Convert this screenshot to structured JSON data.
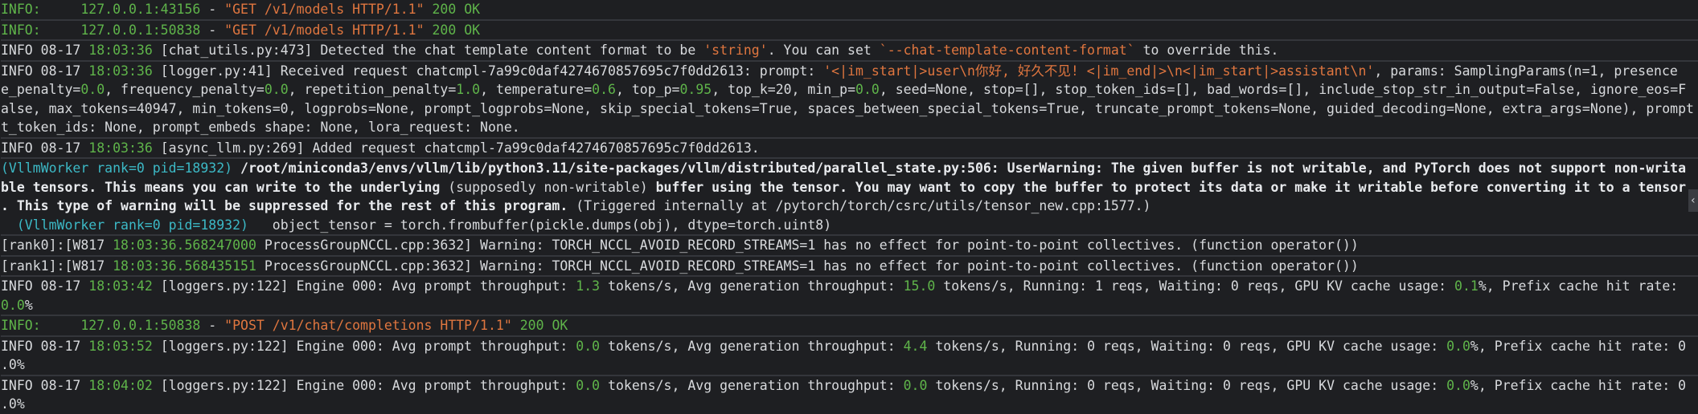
{
  "colors": {
    "background": "#1e1f22",
    "green": "#5fb44a",
    "orange": "#e0763f",
    "cyan": "#3cb9c6",
    "text": "#d8dadd"
  },
  "lines": [
    {
      "segments": [
        {
          "t": "INFO:     ",
          "cls": "g"
        },
        {
          "t": "127.0.0.1:43156",
          "cls": "g"
        },
        {
          "t": " - ",
          "cls": "w"
        },
        {
          "t": "\"GET /v1/models HTTP/1.1\"",
          "cls": "o"
        },
        {
          "t": " 200 OK",
          "cls": "g"
        }
      ],
      "sep": true
    },
    {
      "segments": [
        {
          "t": "INFO:     ",
          "cls": "g"
        },
        {
          "t": "127.0.0.1:50838",
          "cls": "g"
        },
        {
          "t": " - ",
          "cls": "w"
        },
        {
          "t": "\"GET /v1/models HTTP/1.1\"",
          "cls": "o"
        },
        {
          "t": " 200 OK",
          "cls": "g"
        }
      ],
      "sep": true
    },
    {
      "segments": [
        {
          "t": "INFO 08-17 ",
          "cls": "w"
        },
        {
          "t": "18:03:36",
          "cls": "g"
        },
        {
          "t": " [chat_utils.py:473] Detected the chat template content format to be ",
          "cls": "w"
        },
        {
          "t": "'string'",
          "cls": "o"
        },
        {
          "t": ". You can set ",
          "cls": "w"
        },
        {
          "t": "`--chat-template-content-format`",
          "cls": "o"
        },
        {
          "t": " to override this.",
          "cls": "w"
        }
      ],
      "sep": true
    },
    {
      "segments": [
        {
          "t": "INFO 08-17 ",
          "cls": "w"
        },
        {
          "t": "18:03:36",
          "cls": "g"
        },
        {
          "t": " [logger.py:41] Received request chatcmpl-7a99c0daf4274670857695c7f0dd2613: prompt: ",
          "cls": "w"
        },
        {
          "t": "'<|im_start|>user\\n你好, 好久不见! <|im_end|>\\n<|im_start|>assistant\\n'",
          "cls": "o"
        },
        {
          "t": ", params: SamplingParams(n=1, presence",
          "cls": "w"
        }
      ]
    },
    {
      "segments": [
        {
          "t": "e_penalty=",
          "cls": "w"
        },
        {
          "t": "0.0",
          "cls": "g"
        },
        {
          "t": ", frequency_penalty=",
          "cls": "w"
        },
        {
          "t": "0.0",
          "cls": "g"
        },
        {
          "t": ", repetition_penalty=",
          "cls": "w"
        },
        {
          "t": "1.0",
          "cls": "g"
        },
        {
          "t": ", temperature=",
          "cls": "w"
        },
        {
          "t": "0.6",
          "cls": "g"
        },
        {
          "t": ", top_p=",
          "cls": "w"
        },
        {
          "t": "0.95",
          "cls": "g"
        },
        {
          "t": ", top_k=20, min_p=",
          "cls": "w"
        },
        {
          "t": "0.0",
          "cls": "g"
        },
        {
          "t": ", seed=None, stop=[], stop_token_ids=[], bad_words=[], include_stop_str_in_output=False, ignore_eos=F",
          "cls": "w"
        }
      ]
    },
    {
      "segments": [
        {
          "t": "alse, max_tokens=40947, min_tokens=0, logprobs=None, prompt_logprobs=None, skip_special_tokens=True, spaces_between_special_tokens=True, truncate_prompt_tokens=None, guided_decoding=None, extra_args=None), prompt",
          "cls": "w"
        }
      ]
    },
    {
      "segments": [
        {
          "t": "t_token_ids: None, prompt_embeds shape: None, lora_request: None.",
          "cls": "w"
        }
      ],
      "sep": true
    },
    {
      "segments": [
        {
          "t": "INFO 08-17 ",
          "cls": "w"
        },
        {
          "t": "18:03:36",
          "cls": "g"
        },
        {
          "t": " [async_llm.py:269] Added request chatcmpl-7a99c0daf4274670857695c7f0dd2613.",
          "cls": "w"
        }
      ],
      "sep": true
    },
    {
      "segments": [
        {
          "t": "(VllmWorker rank=0 pid=18932)",
          "cls": "c"
        },
        {
          "t": " /root/miniconda3/envs/vllm/lib/python3.11/site-packages/vllm/distributed/parallel_state.py:506: UserWarning: The given buffer is not writable, and PyTorch does not support non-writa",
          "cls": "b"
        }
      ]
    },
    {
      "segments": [
        {
          "t": "ble tensors. This means you can write to the underlying ",
          "cls": "b"
        },
        {
          "t": "(supposedly non-writable)",
          "cls": "w"
        },
        {
          "t": " buffer using the tensor. You may want to copy the buffer to protect its data or make it writable before converting it to a tensor",
          "cls": "b"
        }
      ]
    },
    {
      "segments": [
        {
          "t": ". This type of warning will be suppressed for the rest of this program. ",
          "cls": "b"
        },
        {
          "t": "(Triggered internally at /pytorch/torch/csrc/utils/tensor_new.cpp:1577.)",
          "cls": "w"
        }
      ]
    },
    {
      "segments": [
        {
          "t": "  (VllmWorker rank=0 pid=18932)",
          "cls": "c"
        },
        {
          "t": "   object_tensor = torch.frombuffer(pickle.dumps(obj), dtype=torch.uint8)",
          "cls": "w"
        }
      ],
      "sep": true
    },
    {
      "segments": [
        {
          "t": "[rank0]:[W817 ",
          "cls": "w"
        },
        {
          "t": "18:03:36.568247000",
          "cls": "g"
        },
        {
          "t": " ProcessGroupNCCL.cpp:3632] Warning: TORCH_NCCL_AVOID_RECORD_STREAMS=1 has no effect for point-to-point collectives. (function operator())",
          "cls": "w"
        }
      ],
      "sep": true
    },
    {
      "segments": [
        {
          "t": "[rank1]:[W817 ",
          "cls": "w"
        },
        {
          "t": "18:03:36.568435151",
          "cls": "g"
        },
        {
          "t": " ProcessGroupNCCL.cpp:3632] Warning: TORCH_NCCL_AVOID_RECORD_STREAMS=1 has no effect for point-to-point collectives. (function operator())",
          "cls": "w"
        }
      ],
      "sep": true
    },
    {
      "segments": [
        {
          "t": "INFO 08-17 ",
          "cls": "w"
        },
        {
          "t": "18:03:42",
          "cls": "g"
        },
        {
          "t": " [loggers.py:122] Engine 000: Avg prompt throughput: ",
          "cls": "w"
        },
        {
          "t": "1.3",
          "cls": "g"
        },
        {
          "t": " tokens/s, Avg generation throughput: ",
          "cls": "w"
        },
        {
          "t": "15.0",
          "cls": "g"
        },
        {
          "t": " tokens/s, Running: 1 reqs, Waiting: 0 reqs, GPU KV cache usage: ",
          "cls": "w"
        },
        {
          "t": "0.1",
          "cls": "g"
        },
        {
          "t": "%, Prefix cache hit rate: ",
          "cls": "w"
        }
      ]
    },
    {
      "segments": [
        {
          "t": "0.0",
          "cls": "g"
        },
        {
          "t": "%",
          "cls": "w"
        }
      ],
      "sep": true
    },
    {
      "segments": [
        {
          "t": "INFO:     ",
          "cls": "g"
        },
        {
          "t": "127.0.0.1:50838",
          "cls": "g"
        },
        {
          "t": " - ",
          "cls": "w"
        },
        {
          "t": "\"POST /v1/chat/completions HTTP/1.1\"",
          "cls": "o"
        },
        {
          "t": " 200 OK",
          "cls": "g"
        }
      ],
      "sep": true
    },
    {
      "segments": [
        {
          "t": "INFO 08-17 ",
          "cls": "w"
        },
        {
          "t": "18:03:52",
          "cls": "g"
        },
        {
          "t": " [loggers.py:122] Engine 000: Avg prompt throughput: ",
          "cls": "w"
        },
        {
          "t": "0.0",
          "cls": "g"
        },
        {
          "t": " tokens/s, Avg generation throughput: ",
          "cls": "w"
        },
        {
          "t": "4.4",
          "cls": "g"
        },
        {
          "t": " tokens/s, Running: 0 reqs, Waiting: 0 reqs, GPU KV cache usage: ",
          "cls": "w"
        },
        {
          "t": "0.0",
          "cls": "g"
        },
        {
          "t": "%, Prefix cache hit rate: 0",
          "cls": "w"
        }
      ]
    },
    {
      "segments": [
        {
          "t": ".0%",
          "cls": "w"
        }
      ],
      "sep": true
    },
    {
      "segments": [
        {
          "t": "INFO 08-17 ",
          "cls": "w"
        },
        {
          "t": "18:04:02",
          "cls": "g"
        },
        {
          "t": " [loggers.py:122] Engine 000: Avg prompt throughput: ",
          "cls": "w"
        },
        {
          "t": "0.0",
          "cls": "g"
        },
        {
          "t": " tokens/s, Avg generation throughput: ",
          "cls": "w"
        },
        {
          "t": "0.0",
          "cls": "g"
        },
        {
          "t": " tokens/s, Running: 0 reqs, Waiting: 0 reqs, GPU KV cache usage: ",
          "cls": "w"
        },
        {
          "t": "0.0",
          "cls": "g"
        },
        {
          "t": "%, Prefix cache hit rate: 0",
          "cls": "w"
        }
      ]
    },
    {
      "segments": [
        {
          "t": ".0%",
          "cls": "w"
        }
      ]
    }
  ],
  "scroll_arrow": "‹",
  "scroll_icon": "chevron-left-icon"
}
